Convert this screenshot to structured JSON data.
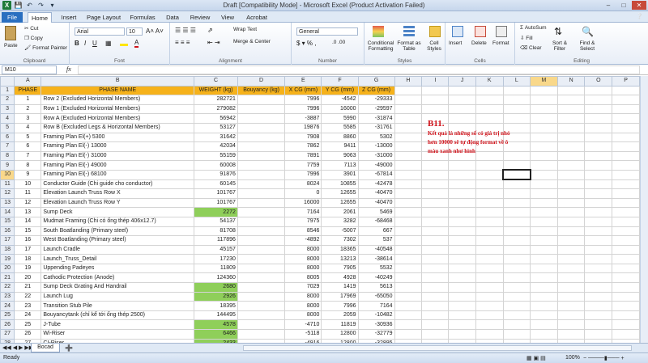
{
  "window": {
    "title": "Draft  [Compatibility Mode] - Microsoft Excel (Product Activation Failed)"
  },
  "tabs": [
    "File",
    "Home",
    "Insert",
    "Page Layout",
    "Formulas",
    "Data",
    "Review",
    "View",
    "Acrobat"
  ],
  "ribbon": {
    "clipboard": {
      "paste": "Paste",
      "cut": "Cut",
      "copy": "Copy",
      "format_painter": "Format Painter",
      "label": "Clipboard"
    },
    "font": {
      "name": "Arial",
      "size": "10",
      "label": "Font"
    },
    "alignment": {
      "wrap": "Wrap Text",
      "merge": "Merge & Center",
      "label": "Alignment"
    },
    "number": {
      "format": "General",
      "label": "Number"
    },
    "styles": {
      "conditional": "Conditional Formatting",
      "format_table": "Format as Table",
      "cell_styles": "Cell Styles",
      "label": "Styles"
    },
    "cells": {
      "insert": "Insert",
      "delete": "Delete",
      "format": "Format",
      "label": "Cells"
    },
    "editing": {
      "autosum": "AutoSum",
      "fill": "Fill",
      "clear": "Clear",
      "sort": "Sort & Filter",
      "find": "Find & Select",
      "label": "Editing"
    }
  },
  "formula_bar": {
    "name_box": "M10",
    "fx": "fx",
    "value": ""
  },
  "columns": [
    "A",
    "B",
    "C",
    "D",
    "E",
    "F",
    "G",
    "H",
    "I",
    "J",
    "K",
    "L",
    "M",
    "N",
    "O",
    "P",
    "Q"
  ],
  "header_row": [
    "PHASE",
    "PHASE NAME",
    "WEIGHT (kg)",
    "Bouyancy (kg)",
    "X CG (mm)",
    "Y CG (mm)",
    "Z CG (mm)"
  ],
  "rows": [
    {
      "n": "2",
      "a": "1",
      "b": "Row 2 (Excluded Horizontal Members)",
      "c": "282721",
      "e": "7996",
      "f": "-4542",
      "g": "-29333"
    },
    {
      "n": "3",
      "a": "2",
      "b": "Row 1 (Excluded Horizontal Members)",
      "c": "279082",
      "e": "7996",
      "f": "16000",
      "g": "-29597"
    },
    {
      "n": "4",
      "a": "3",
      "b": "Row A (Excluded Horizontal Members)",
      "c": "56942",
      "e": "-3887",
      "f": "5990",
      "g": "-31874"
    },
    {
      "n": "5",
      "a": "4",
      "b": "Row B (Excluded Legs & Horizontal Members)",
      "c": "53127",
      "e": "19876",
      "f": "5585",
      "g": "-31761"
    },
    {
      "n": "6",
      "a": "5",
      "b": "Framing Plan El(+) 5300",
      "c": "31642",
      "e": "7908",
      "f": "8860",
      "g": "5302"
    },
    {
      "n": "7",
      "a": "6",
      "b": "Framing Plan El(-) 13000",
      "c": "42034",
      "e": "7862",
      "f": "9411",
      "g": "-13000"
    },
    {
      "n": "8",
      "a": "7",
      "b": "Framing Plan El(-) 31000",
      "c": "55159",
      "e": "7891",
      "f": "9063",
      "g": "-31000"
    },
    {
      "n": "9",
      "a": "8",
      "b": "Framing Plan El(-) 49000",
      "c": "60008",
      "e": "7759",
      "f": "7113",
      "g": "-49000"
    },
    {
      "n": "10",
      "a": "9",
      "b": "Framing Plan El(-) 68100",
      "c": "91876",
      "e": "7996",
      "f": "3901",
      "g": "-67814"
    },
    {
      "n": "11",
      "a": "10",
      "b": "Conductor Guide (Chi guide cho conductor)",
      "c": "60145",
      "e": "8024",
      "f": "10855",
      "g": "-42478"
    },
    {
      "n": "12",
      "a": "11",
      "b": "Elevation Launch Truss Row  X",
      "c": "101767",
      "e": "0",
      "f": "12655",
      "g": "-40470"
    },
    {
      "n": "13",
      "a": "12",
      "b": "Elevation Launch Truss Row Y",
      "c": "101767",
      "e": "16000",
      "f": "12655",
      "g": "-40470"
    },
    {
      "n": "14",
      "a": "13",
      "b": "Sump Deck",
      "c": "2272",
      "e": "7164",
      "f": "2061",
      "g": "5469"
    },
    {
      "n": "15",
      "a": "14",
      "b": "Mudmat Framing (Chi có ống thép 406x12.7)",
      "c": "54137",
      "e": "7975",
      "f": "3282",
      "g": "-68468"
    },
    {
      "n": "16",
      "a": "15",
      "b": "South Boatlanding (Primary steel)",
      "c": "81708",
      "e": "8546",
      "f": "-5007",
      "g": "667"
    },
    {
      "n": "17",
      "a": "16",
      "b": "West Boatlanding (Primary steel)",
      "c": "117896",
      "e": "-4892",
      "f": "7302",
      "g": "537"
    },
    {
      "n": "18",
      "a": "17",
      "b": "Launch Cradle",
      "c": "45157",
      "e": "8000",
      "f": "18365",
      "g": "-40548"
    },
    {
      "n": "19",
      "a": "18",
      "b": "Launch_Truss_Detail",
      "c": "17230",
      "e": "8000",
      "f": "13213",
      "g": "-38614"
    },
    {
      "n": "20",
      "a": "19",
      "b": "Uppending Padeyes",
      "c": "11809",
      "e": "8000",
      "f": "7905",
      "g": "5532"
    },
    {
      "n": "21",
      "a": "20",
      "b": "Cathodic Protection (Anode)",
      "c": "124360",
      "e": "8005",
      "f": "4928",
      "g": "-40249"
    },
    {
      "n": "22",
      "a": "21",
      "b": "Sump Deck Grating And Handrail",
      "c": "2680",
      "e": "7029",
      "f": "1419",
      "g": "5613"
    },
    {
      "n": "23",
      "a": "22",
      "b": "Launch Lug",
      "c": "2926",
      "e": "8000",
      "f": "17969",
      "g": "-65050"
    },
    {
      "n": "24",
      "a": "23",
      "b": "Transition Stub Pile",
      "c": "18395",
      "e": "8000",
      "f": "7996",
      "g": "7164"
    },
    {
      "n": "25",
      "a": "24",
      "b": "Bouyancytank (chỉ kể tới ống thép 2500)",
      "c": "144495",
      "e": "8000",
      "f": "2059",
      "g": "-10482"
    },
    {
      "n": "26",
      "a": "25",
      "b": "J-Tube",
      "c": "4578",
      "e": "-4710",
      "f": "11819",
      "g": "-30936"
    },
    {
      "n": "27",
      "a": "26",
      "b": "Wi-Riser",
      "c": "6466",
      "e": "-5118",
      "f": "12800",
      "g": "-32779"
    },
    {
      "n": "28",
      "a": "27",
      "b": "CI-Riser",
      "c": "2433",
      "e": "-4916",
      "f": "12800",
      "g": "-32895"
    }
  ],
  "annotation": {
    "title": "B11.",
    "text": "Kết quả là những số có giá trị nhỏ hơn 10000 sẽ tự động format về ô màu xanh như hình"
  },
  "sheet_tabs": [
    "Bocad"
  ],
  "status": {
    "ready": "Ready",
    "zoom": "100%"
  }
}
